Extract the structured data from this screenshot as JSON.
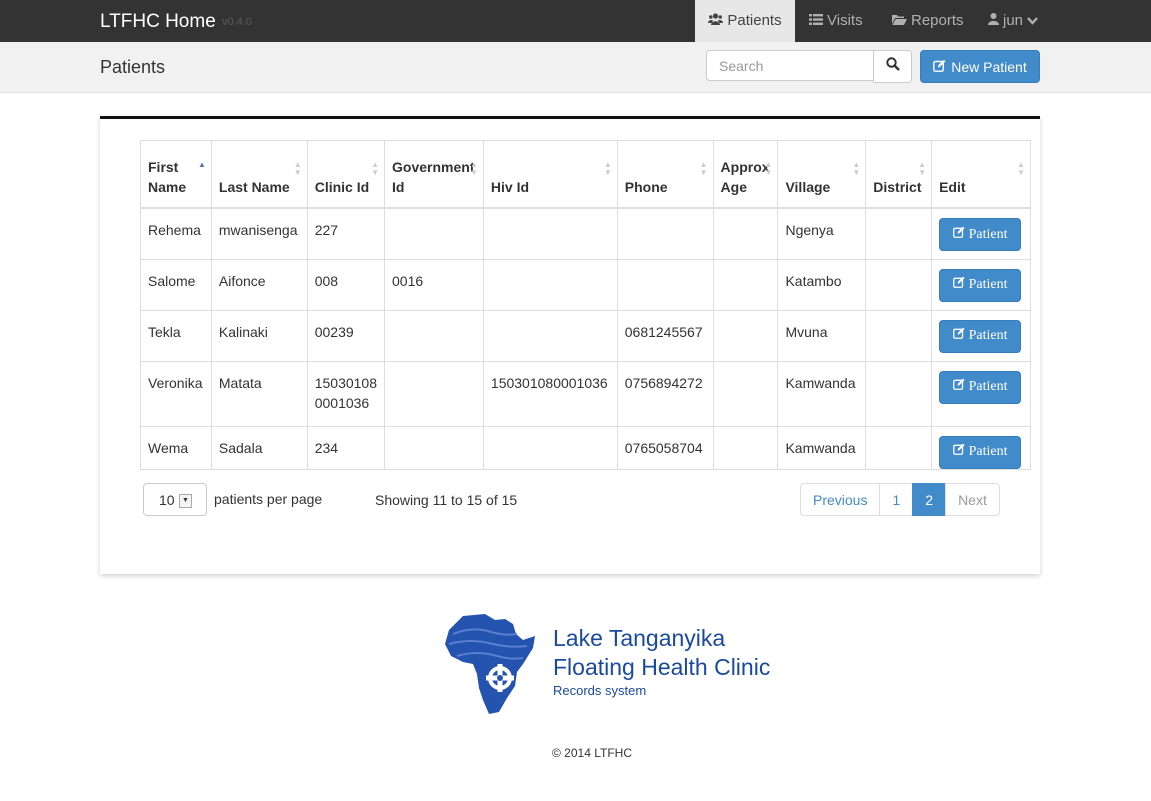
{
  "navbar": {
    "brand": "LTFHC Home",
    "version": "v0.4.0",
    "items": [
      {
        "label": "Patients",
        "icon": "users-icon"
      },
      {
        "label": "Visits",
        "icon": "list-icon"
      },
      {
        "label": "Reports",
        "icon": "folder-open-icon"
      }
    ],
    "user": "jun",
    "active_item": "Patients"
  },
  "subheader": {
    "title": "Patients",
    "search_placeholder": "Search",
    "new_patient_label": "New Patient"
  },
  "table": {
    "columns": [
      "First Name",
      "Last Name",
      "Clinic Id",
      "Government Id",
      "Hiv Id",
      "Phone",
      "Approx Age",
      "Village",
      "District",
      "Edit"
    ],
    "sorted_column": "First Name",
    "sort_direction": "ascending",
    "edit_label": "Patient",
    "rows": [
      {
        "first": "Rehema",
        "last": "mwanisenga",
        "clinic": "227",
        "gov": "",
        "hiv": "",
        "phone": "",
        "age": "",
        "village": "Ngenya",
        "district": ""
      },
      {
        "first": "Salome",
        "last": "Aifonce",
        "clinic": "008",
        "gov": "0016",
        "hiv": "",
        "phone": "",
        "age": "",
        "village": "Katambo",
        "district": ""
      },
      {
        "first": "Tekla",
        "last": "Kalinaki",
        "clinic": "00239",
        "gov": "",
        "hiv": "",
        "phone": "0681245567",
        "age": "",
        "village": "Mvuna",
        "district": ""
      },
      {
        "first": "Veronika",
        "last": "Matata",
        "clinic": "150301080001036",
        "gov": "",
        "hiv": "150301080001036",
        "phone": "0756894272",
        "age": "",
        "village": "Kamwanda",
        "district": ""
      },
      {
        "first": "Wema",
        "last": "Sadala",
        "clinic": "234",
        "gov": "",
        "hiv": "",
        "phone": "0765058704",
        "age": "",
        "village": "Kamwanda",
        "district": ""
      }
    ]
  },
  "controls": {
    "per_page_value": "10",
    "per_page_label": "patients per page",
    "showing_text": "Showing 11 to 15 of 15"
  },
  "pagination": {
    "previous": "Previous",
    "pages": [
      "1",
      "2"
    ],
    "active_page": "2",
    "next": "Next"
  },
  "footer": {
    "org_line1": "Lake Tanganyika",
    "org_line2": "Floating Health Clinic",
    "org_sub": "Records system",
    "copyright": "© 2014 LTFHC"
  },
  "colors": {
    "navbar_bg": "#333333",
    "primary": "#428bca",
    "logo_blue": "#1a4a9e"
  }
}
